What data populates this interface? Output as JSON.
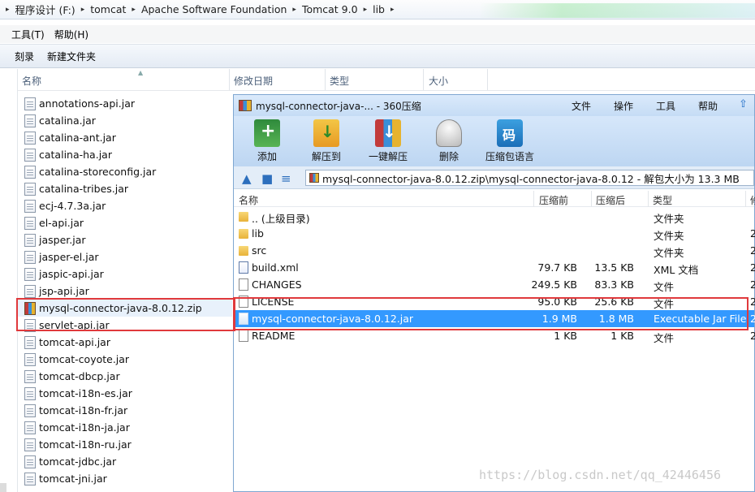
{
  "explorer": {
    "breadcrumb": [
      "程序设计 (F:)",
      "tomcat",
      "Apache Software Foundation",
      "Tomcat 9.0",
      "lib"
    ],
    "menu": [
      "工具(T)",
      "帮助(H)"
    ],
    "toolbar": [
      "刻录",
      "新建文件夹"
    ],
    "columns": {
      "name": "名称",
      "modified": "修改日期",
      "type": "类型",
      "size": "大小"
    },
    "files": [
      {
        "name": "annotations-api.jar",
        "icon": "jar-file-icon"
      },
      {
        "name": "catalina.jar",
        "icon": "jar-file-icon"
      },
      {
        "name": "catalina-ant.jar",
        "icon": "jar-file-icon"
      },
      {
        "name": "catalina-ha.jar",
        "icon": "jar-file-icon"
      },
      {
        "name": "catalina-storeconfig.jar",
        "icon": "jar-file-icon"
      },
      {
        "name": "catalina-tribes.jar",
        "icon": "jar-file-icon"
      },
      {
        "name": "ecj-4.7.3a.jar",
        "icon": "jar-file-icon"
      },
      {
        "name": "el-api.jar",
        "icon": "jar-file-icon"
      },
      {
        "name": "jasper.jar",
        "icon": "jar-file-icon"
      },
      {
        "name": "jasper-el.jar",
        "icon": "jar-file-icon"
      },
      {
        "name": "jaspic-api.jar",
        "icon": "jar-file-icon"
      },
      {
        "name": "jsp-api.jar",
        "icon": "jar-file-icon"
      },
      {
        "name": "mysql-connector-java-8.0.12.zip",
        "icon": "zip-archive-icon"
      },
      {
        "name": "servlet-api.jar",
        "icon": "jar-file-icon"
      },
      {
        "name": "tomcat-api.jar",
        "icon": "jar-file-icon"
      },
      {
        "name": "tomcat-coyote.jar",
        "icon": "jar-file-icon"
      },
      {
        "name": "tomcat-dbcp.jar",
        "icon": "jar-file-icon"
      },
      {
        "name": "tomcat-i18n-es.jar",
        "icon": "jar-file-icon"
      },
      {
        "name": "tomcat-i18n-fr.jar",
        "icon": "jar-file-icon"
      },
      {
        "name": "tomcat-i18n-ja.jar",
        "icon": "jar-file-icon"
      },
      {
        "name": "tomcat-i18n-ru.jar",
        "icon": "jar-file-icon"
      },
      {
        "name": "tomcat-jdbc.jar",
        "icon": "jar-file-icon"
      },
      {
        "name": "tomcat-jni.jar",
        "icon": "jar-file-icon"
      }
    ]
  },
  "archive": {
    "title": "mysql-connector-java-... - 360压缩",
    "menu": [
      "文件",
      "操作",
      "工具",
      "帮助"
    ],
    "tools": [
      "添加",
      "解压到",
      "一键解压",
      "删除",
      "压缩包语言"
    ],
    "path": "mysql-connector-java-8.0.12.zip\\mysql-connector-java-8.0.12 - 解包大小为 13.3 MB",
    "columns": {
      "name": "名称",
      "compressed": "压缩前",
      "packed": "压缩后",
      "type": "类型",
      "extra": "修"
    },
    "rows": [
      {
        "name": ".. (上级目录)",
        "before": "",
        "after": "",
        "type": "文件夹",
        "extra": "",
        "icon": "folder-icon"
      },
      {
        "name": "lib",
        "before": "",
        "after": "",
        "type": "文件夹",
        "extra": "2",
        "icon": "folder-icon"
      },
      {
        "name": "src",
        "before": "",
        "after": "",
        "type": "文件夹",
        "extra": "2",
        "icon": "folder-icon"
      },
      {
        "name": "build.xml",
        "before": "79.7 KB",
        "after": "13.5 KB",
        "type": "XML 文档",
        "extra": "2",
        "icon": "xml-file-icon"
      },
      {
        "name": "CHANGES",
        "before": "249.5 KB",
        "after": "83.3 KB",
        "type": "文件",
        "extra": "2",
        "icon": "file-icon"
      },
      {
        "name": "LICENSE",
        "before": "95.0 KB",
        "after": "25.6 KB",
        "type": "文件",
        "extra": "2",
        "icon": "file-icon"
      },
      {
        "name": "mysql-connector-java-8.0.12.jar",
        "before": "1.9 MB",
        "after": "1.8 MB",
        "type": "Executable Jar File",
        "extra": "2",
        "icon": "jar-file-icon"
      },
      {
        "name": "README",
        "before": "1 KB",
        "after": "1 KB",
        "type": "文件",
        "extra": "2",
        "icon": "file-icon"
      }
    ]
  },
  "watermark": "https://blog.csdn.net/qq_42446456",
  "colors": {
    "selection": "#3399ff",
    "highlight_box": "#e0393c",
    "archive_chrome": "#c5dcf5"
  }
}
